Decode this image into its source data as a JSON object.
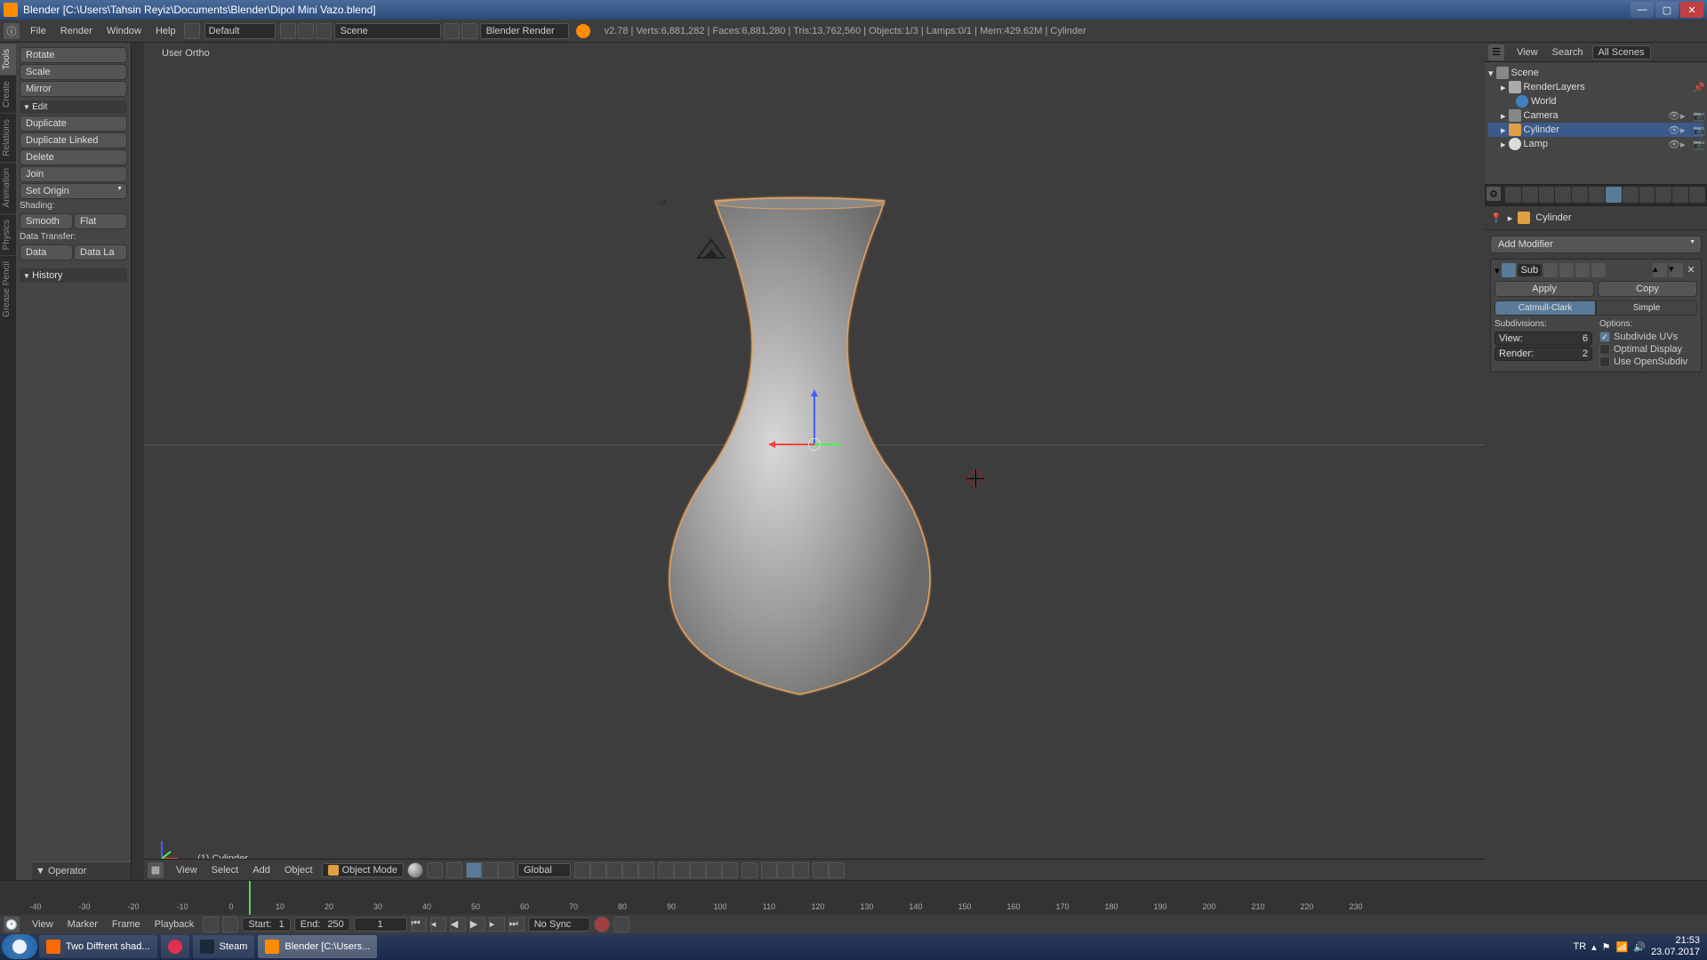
{
  "window": {
    "title": "Blender [C:\\Users\\Tahsin Reyiz\\Documents\\Blender\\Dipol Mini Vazo.blend]"
  },
  "menubar": {
    "file": "File",
    "render": "Render",
    "window": "Window",
    "help": "Help",
    "layout": "Default",
    "scene": "Scene",
    "renderer": "Blender Render"
  },
  "stats": {
    "text": "v2.78 | Verts:6,881,282 | Faces:6,881,280 | Tris:13,762,560 | Objects:1/3 | Lamps:0/1 | Mem:429.62M | Cylinder"
  },
  "left_tabs": [
    "Tools",
    "Create",
    "Relations",
    "Animation",
    "Physics",
    "Grease Pencil"
  ],
  "tool_panel": {
    "rotate": "Rotate",
    "scale": "Scale",
    "mirror": "Mirror",
    "edit_header": "Edit",
    "duplicate": "Duplicate",
    "duplicate_linked": "Duplicate Linked",
    "delete": "Delete",
    "join": "Join",
    "set_origin": "Set Origin",
    "shading_label": "Shading:",
    "smooth": "Smooth",
    "flat": "Flat",
    "data_transfer_label": "Data Transfer:",
    "data": "Data",
    "data_la": "Data La",
    "history": "History"
  },
  "operator_panel": "Operator",
  "viewport": {
    "label": "User Ortho",
    "object_name": "(1) Cylinder"
  },
  "viewport_header": {
    "view": "View",
    "select": "Select",
    "add": "Add",
    "object": "Object",
    "mode": "Object Mode",
    "orientation": "Global"
  },
  "outliner": {
    "view": "View",
    "search": "Search",
    "filter": "All Scenes",
    "scene": "Scene",
    "render_layers": "RenderLayers",
    "world": "World",
    "camera": "Camera",
    "cylinder": "Cylinder",
    "lamp": "Lamp"
  },
  "props": {
    "context_name": "Cylinder",
    "add_modifier": "Add Modifier",
    "modifier_name": "Sub",
    "apply": "Apply",
    "copy": "Copy",
    "catmull": "Catmull-Clark",
    "simple": "Simple",
    "subdivisions_label": "Subdivisions:",
    "view_label": "View:",
    "view_value": "6",
    "render_label": "Render:",
    "render_value": "2",
    "options_label": "Options:",
    "subdivide_uvs": "Subdivide UVs",
    "optimal_display": "Optimal Display",
    "use_opensubdiv": "Use OpenSubdiv"
  },
  "timeline": {
    "view": "View",
    "marker": "Marker",
    "frame": "Frame",
    "playback": "Playback",
    "start_label": "Start:",
    "start": "1",
    "end_label": "End:",
    "end": "250",
    "current": "1",
    "sync": "No Sync",
    "ticks": [
      -40,
      -30,
      -20,
      -10,
      0,
      10,
      20,
      30,
      40,
      50,
      60,
      70,
      80,
      90,
      100,
      110,
      120,
      130,
      140,
      150,
      160,
      170,
      180,
      190,
      200,
      210,
      220,
      230
    ]
  },
  "taskbar": {
    "firefox": "Two Diffrent shad...",
    "steam": "Steam",
    "blender": "Blender [C:\\Users...",
    "lang": "TR",
    "time": "21:53",
    "date": "23.07.2017"
  }
}
